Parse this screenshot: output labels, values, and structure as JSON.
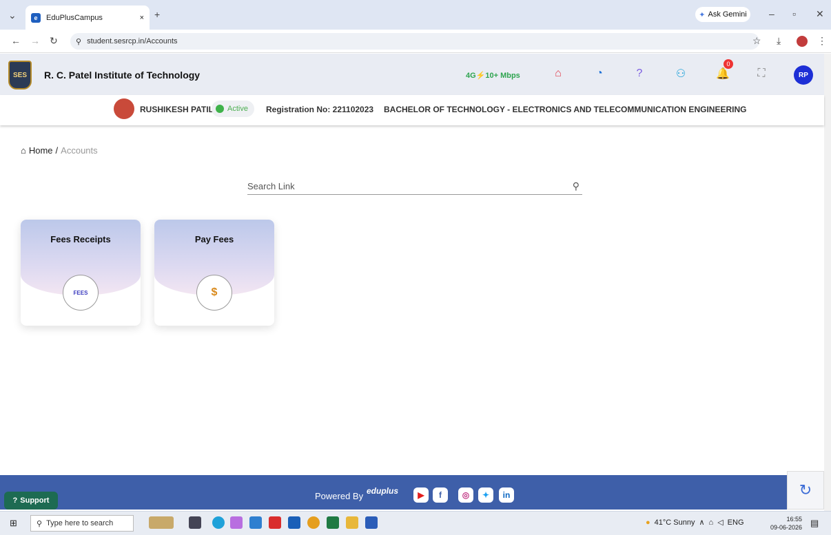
{
  "browser": {
    "tab_title": "EduPlusCampus",
    "close_tab": "×",
    "new_tab": "+",
    "url": "student.sesrcp.in/Accounts",
    "ask_gemini": "Ask Gemini"
  },
  "header": {
    "institute": "R. C. Patel Institute of Technology",
    "logo_text": "SES",
    "network": "4G⚡10+ Mbps",
    "notification_count": "0",
    "avatar_initials": "RP"
  },
  "student": {
    "name": "RUSHIKESH PATIL",
    "status": "Active",
    "registration": "Registration No: 221102023",
    "program": "BACHELOR OF TECHNOLOGY - ELECTRONICS AND TELECOMMUNICATION ENGINEERING"
  },
  "breadcrumb": {
    "home": "Home",
    "separator": "/",
    "current": "Accounts"
  },
  "search": {
    "placeholder": "Search Link"
  },
  "cards": [
    {
      "title": "Fees Receipts",
      "icon_label": "FEES"
    },
    {
      "title": "Pay Fees",
      "icon_label": "$"
    }
  ],
  "footer": {
    "support": "Support",
    "powered_by": "Powered By",
    "brand": "eduplus"
  },
  "taskbar": {
    "search_placeholder": "Type here to search",
    "weather": "41°C  Sunny",
    "language": "ENG",
    "time": "16:55",
    "date": "09-06-2026"
  },
  "colors": {
    "footer_bg": "#3e5fa9",
    "active_green": "#3fb24a",
    "avatar_blue": "#1d2fd6",
    "support_green": "#1d6b52"
  }
}
